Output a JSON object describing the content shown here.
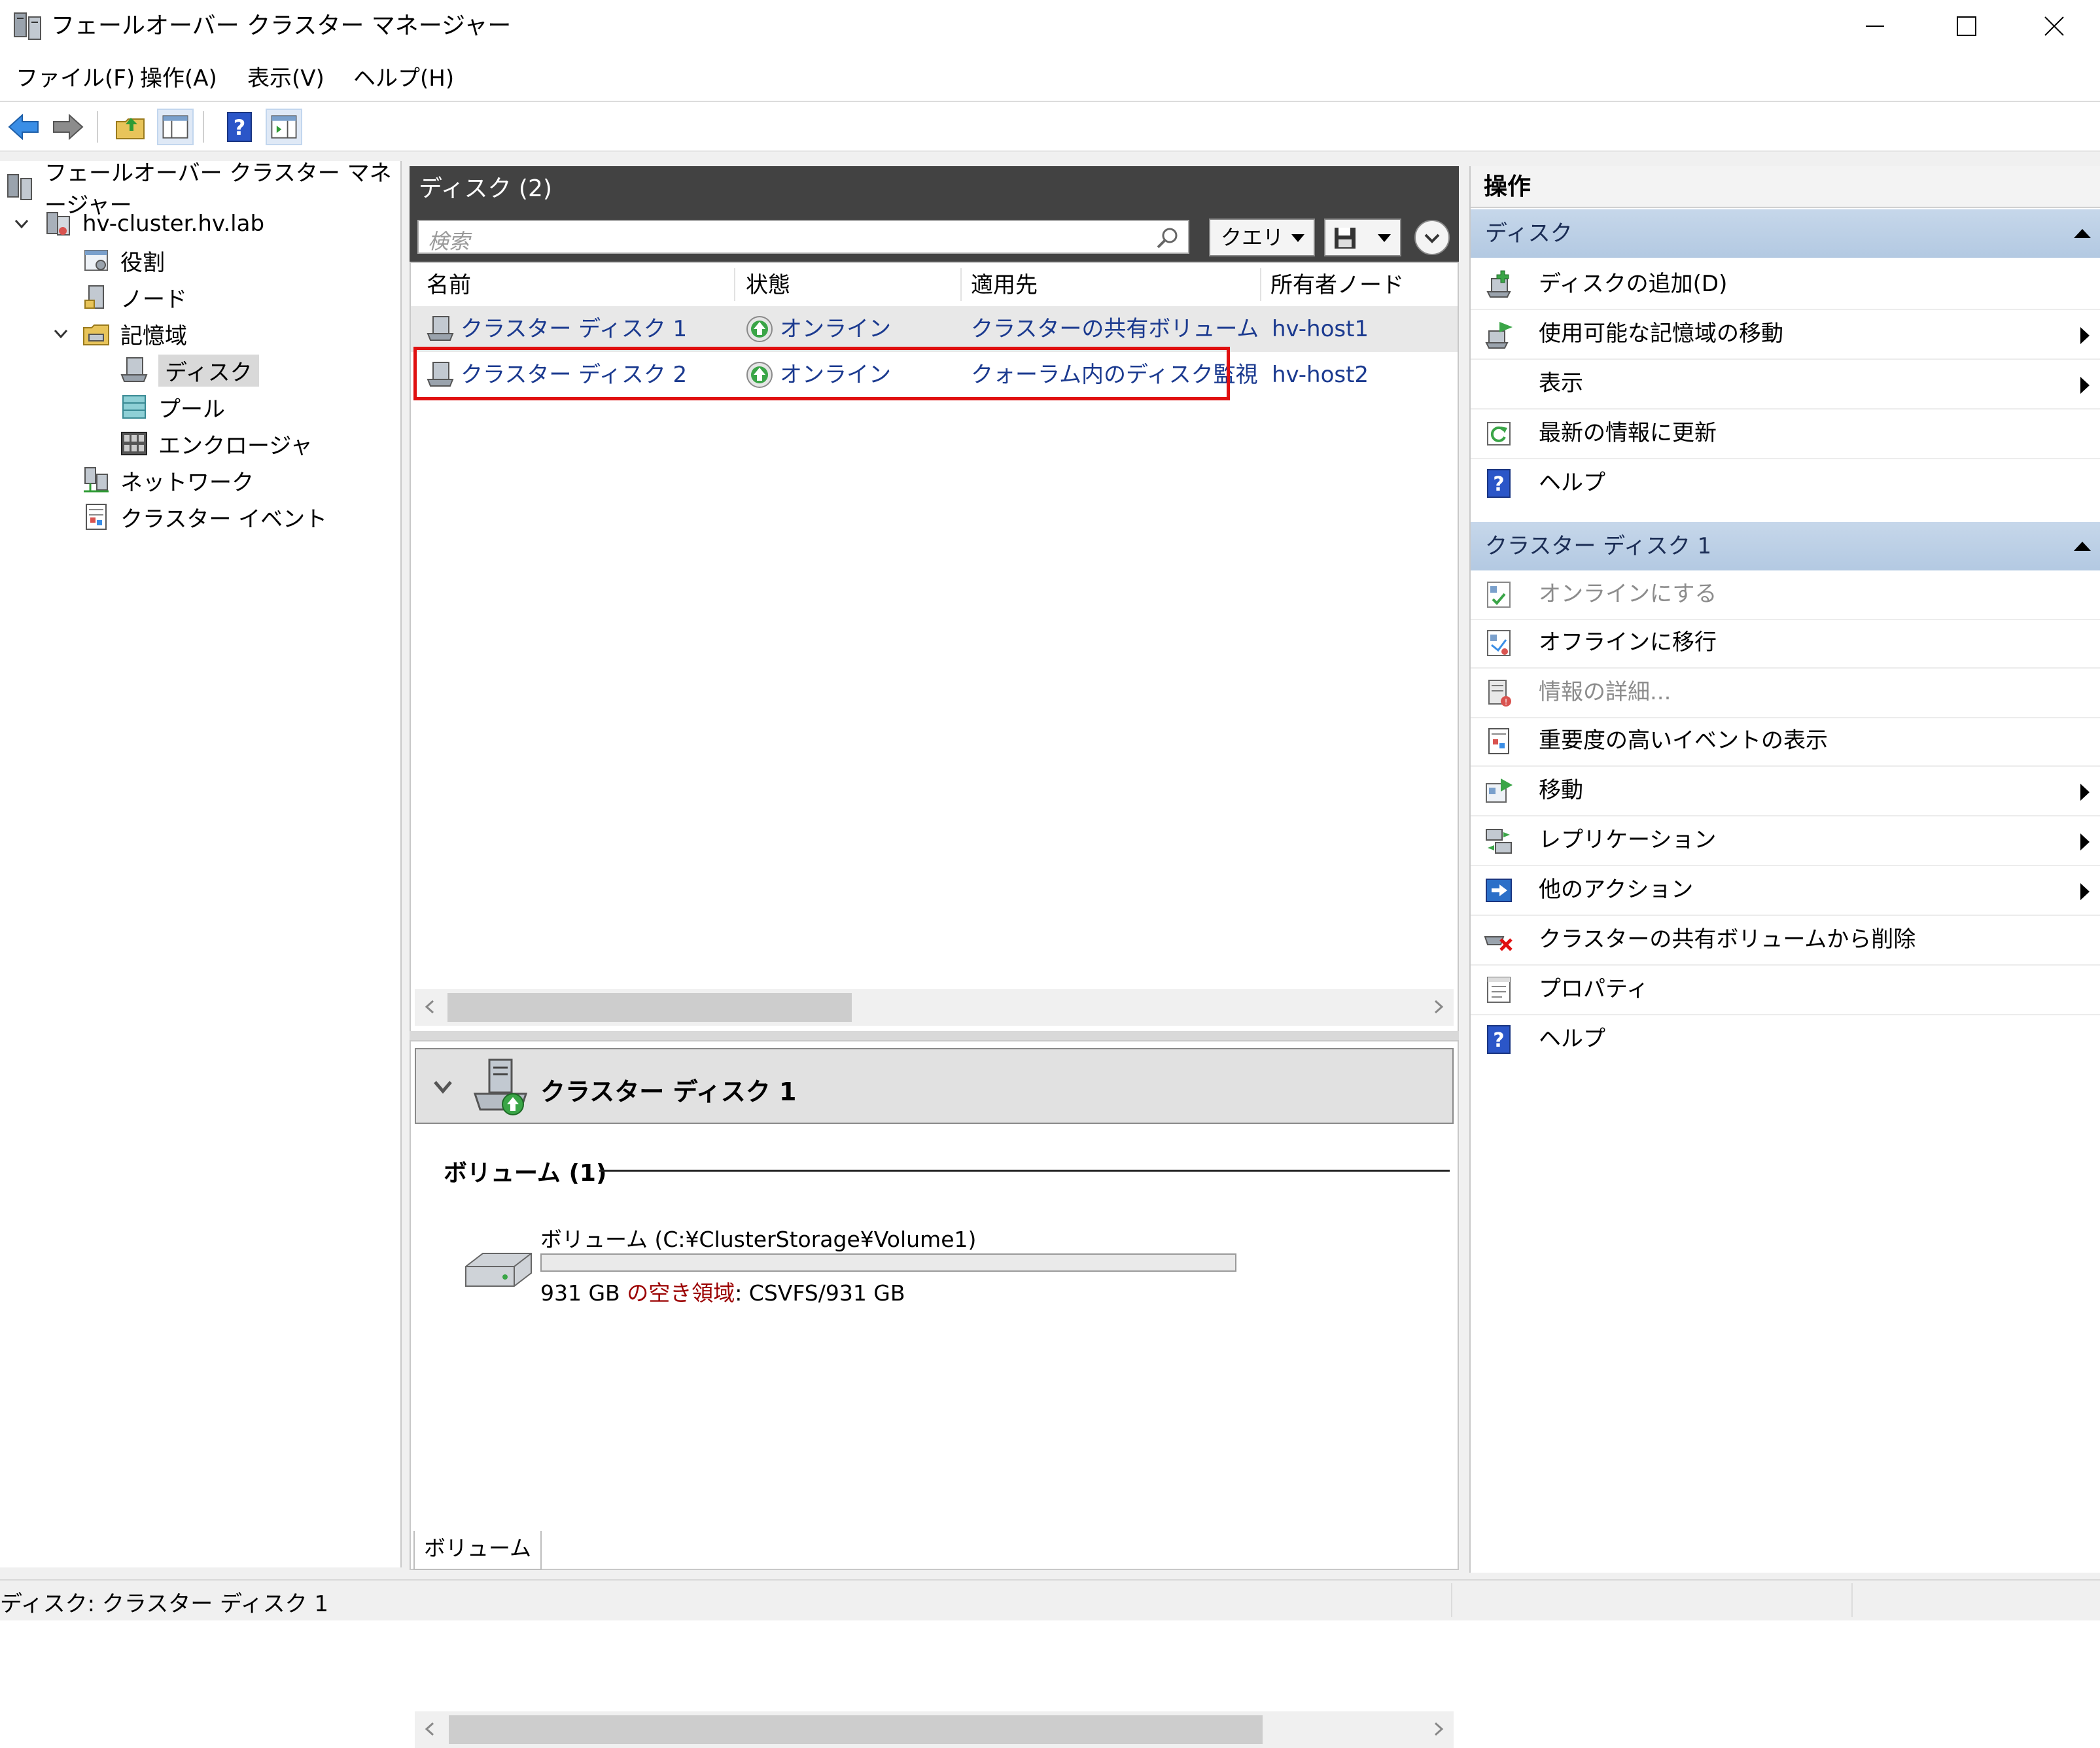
{
  "window": {
    "title": "フェールオーバー クラスター マネージャー",
    "buttons": [
      "minimize-icon",
      "maximize-icon",
      "close-icon"
    ]
  },
  "menubar": [
    {
      "label": "ファイル(F)"
    },
    {
      "label": "操作(A)"
    },
    {
      "label": "表示(V)"
    },
    {
      "label": "ヘルプ(H)"
    }
  ],
  "toolbar": [
    "back-arrow-icon",
    "forward-arrow-icon",
    "up-folder-icon",
    "show-tree-icon",
    "help-icon",
    "show-action-pane-icon"
  ],
  "tree": {
    "root": "フェールオーバー クラスター マネージャー",
    "cluster": "hv-cluster.hv.lab",
    "items": {
      "roles": "役割",
      "nodes": "ノード",
      "storage": "記憶域",
      "disks": "ディスク",
      "pools": "プール",
      "enclosures": "エンクロージャ",
      "networks": "ネットワーク",
      "events": "クラスター イベント"
    }
  },
  "center": {
    "header": "ディスク (2)",
    "search_placeholder": "検索",
    "query_label": "クエリ",
    "columns": [
      "名前",
      "状態",
      "適用先",
      "所有者ノード"
    ],
    "rows": [
      {
        "name": "クラスター ディスク 1",
        "status": "オンライン",
        "assigned": "クラスターの共有ボリューム",
        "owner": "hv-host1"
      },
      {
        "name": "クラスター ディスク 2",
        "status": "オンライン",
        "assigned": "クォーラム内のディスク監視",
        "owner": "hv-host2"
      }
    ]
  },
  "detail": {
    "title": "クラスター ディスク 1",
    "volume_section": "ボリューム (1)",
    "volume_name": "ボリューム (C:¥ClusterStorage¥Volume1)",
    "volume_info_size": "931 GB",
    "volume_info_free_label": "の空き領域",
    "volume_info_fs": ": CSVFS/931 GB",
    "used_fraction": 0.0,
    "tab": "ボリューム"
  },
  "actions": {
    "header": "操作",
    "section1": "ディスク",
    "section1_items": [
      {
        "label": "ディスクの追加(D)",
        "icon": "add-disk-icon"
      },
      {
        "label": "使用可能な記憶域の移動",
        "icon": "move-storage-icon",
        "submenu": true
      },
      {
        "label": "表示",
        "icon": "",
        "submenu": true
      },
      {
        "label": "最新の情報に更新",
        "icon": "refresh-icon"
      },
      {
        "label": "ヘルプ",
        "icon": "help-icon"
      }
    ],
    "section2": "クラスター ディスク 1",
    "section2_items": [
      {
        "label": "オンラインにする",
        "icon": "bring-online-icon",
        "disabled": true
      },
      {
        "label": "オフラインに移行",
        "icon": "take-offline-icon"
      },
      {
        "label": "情報の詳細...",
        "icon": "info-details-icon",
        "disabled": true
      },
      {
        "label": "重要度の高いイベントの表示",
        "icon": "critical-events-icon"
      },
      {
        "label": "移動",
        "icon": "move-icon",
        "submenu": true
      },
      {
        "label": "レプリケーション",
        "icon": "replication-icon",
        "submenu": true
      },
      {
        "label": "他のアクション",
        "icon": "more-actions-icon",
        "submenu": true
      },
      {
        "label": "クラスターの共有ボリュームから削除",
        "icon": "remove-csv-icon"
      },
      {
        "label": "プロパティ",
        "icon": "properties-icon"
      },
      {
        "label": "ヘルプ",
        "icon": "help-icon"
      }
    ]
  },
  "statusbar": {
    "text": "ディスク: クラスター ディスク 1"
  }
}
